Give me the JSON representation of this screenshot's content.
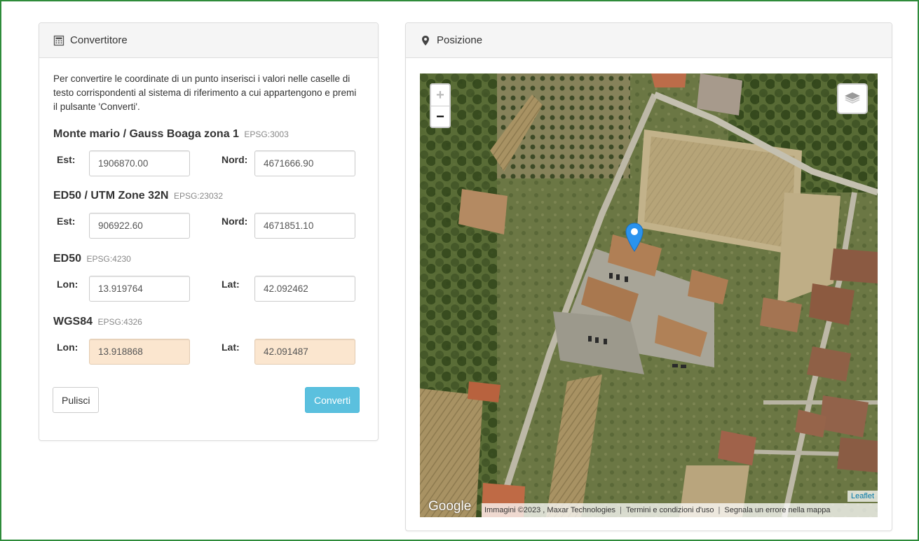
{
  "converter": {
    "title": "Convertitore",
    "description": "Per convertire le coordinate di un punto inserisci i valori nelle caselle di testo corrispondenti al sistema di riferimento a cui appartengono e premi il pulsante 'Converti'.",
    "systems": [
      {
        "name": "Monte mario / Gauss Boaga zona 1",
        "epsg": "EPSG:3003",
        "label1": "Est:",
        "value1": "1906870.00",
        "label2": "Nord:",
        "value2": "4671666.90"
      },
      {
        "name": "ED50 / UTM Zone 32N",
        "epsg": "EPSG:23032",
        "label1": "Est:",
        "value1": "906922.60",
        "label2": "Nord:",
        "value2": "4671851.10"
      },
      {
        "name": "ED50",
        "epsg": "EPSG:4230",
        "label1": "Lon:",
        "value1": "13.919764",
        "label2": "Lat:",
        "value2": "42.092462"
      },
      {
        "name": "WGS84",
        "epsg": "EPSG:4326",
        "label1": "Lon:",
        "value1": "13.918868",
        "label2": "Lat:",
        "value2": "42.091487"
      }
    ],
    "clear_label": "Pulisci",
    "convert_label": "Converti"
  },
  "position": {
    "title": "Posizione",
    "zoom_in": "+",
    "zoom_out": "−",
    "google_logo": "Google",
    "attribution": "Immagini ©2023 , Maxar Technologies",
    "terms": "Termini e condizioni d'uso",
    "report": "Segnala un errore nella mappa",
    "leaflet": "Leaflet"
  },
  "colors": {
    "page_border": "#2e8b3a",
    "result_field_bg": "#fbe6cf",
    "convert_button": "#5bc0de",
    "marker": "#2a93ee"
  },
  "icons": {
    "converter": "calculator-icon",
    "position": "map-marker-icon",
    "layers": "layers-icon"
  }
}
